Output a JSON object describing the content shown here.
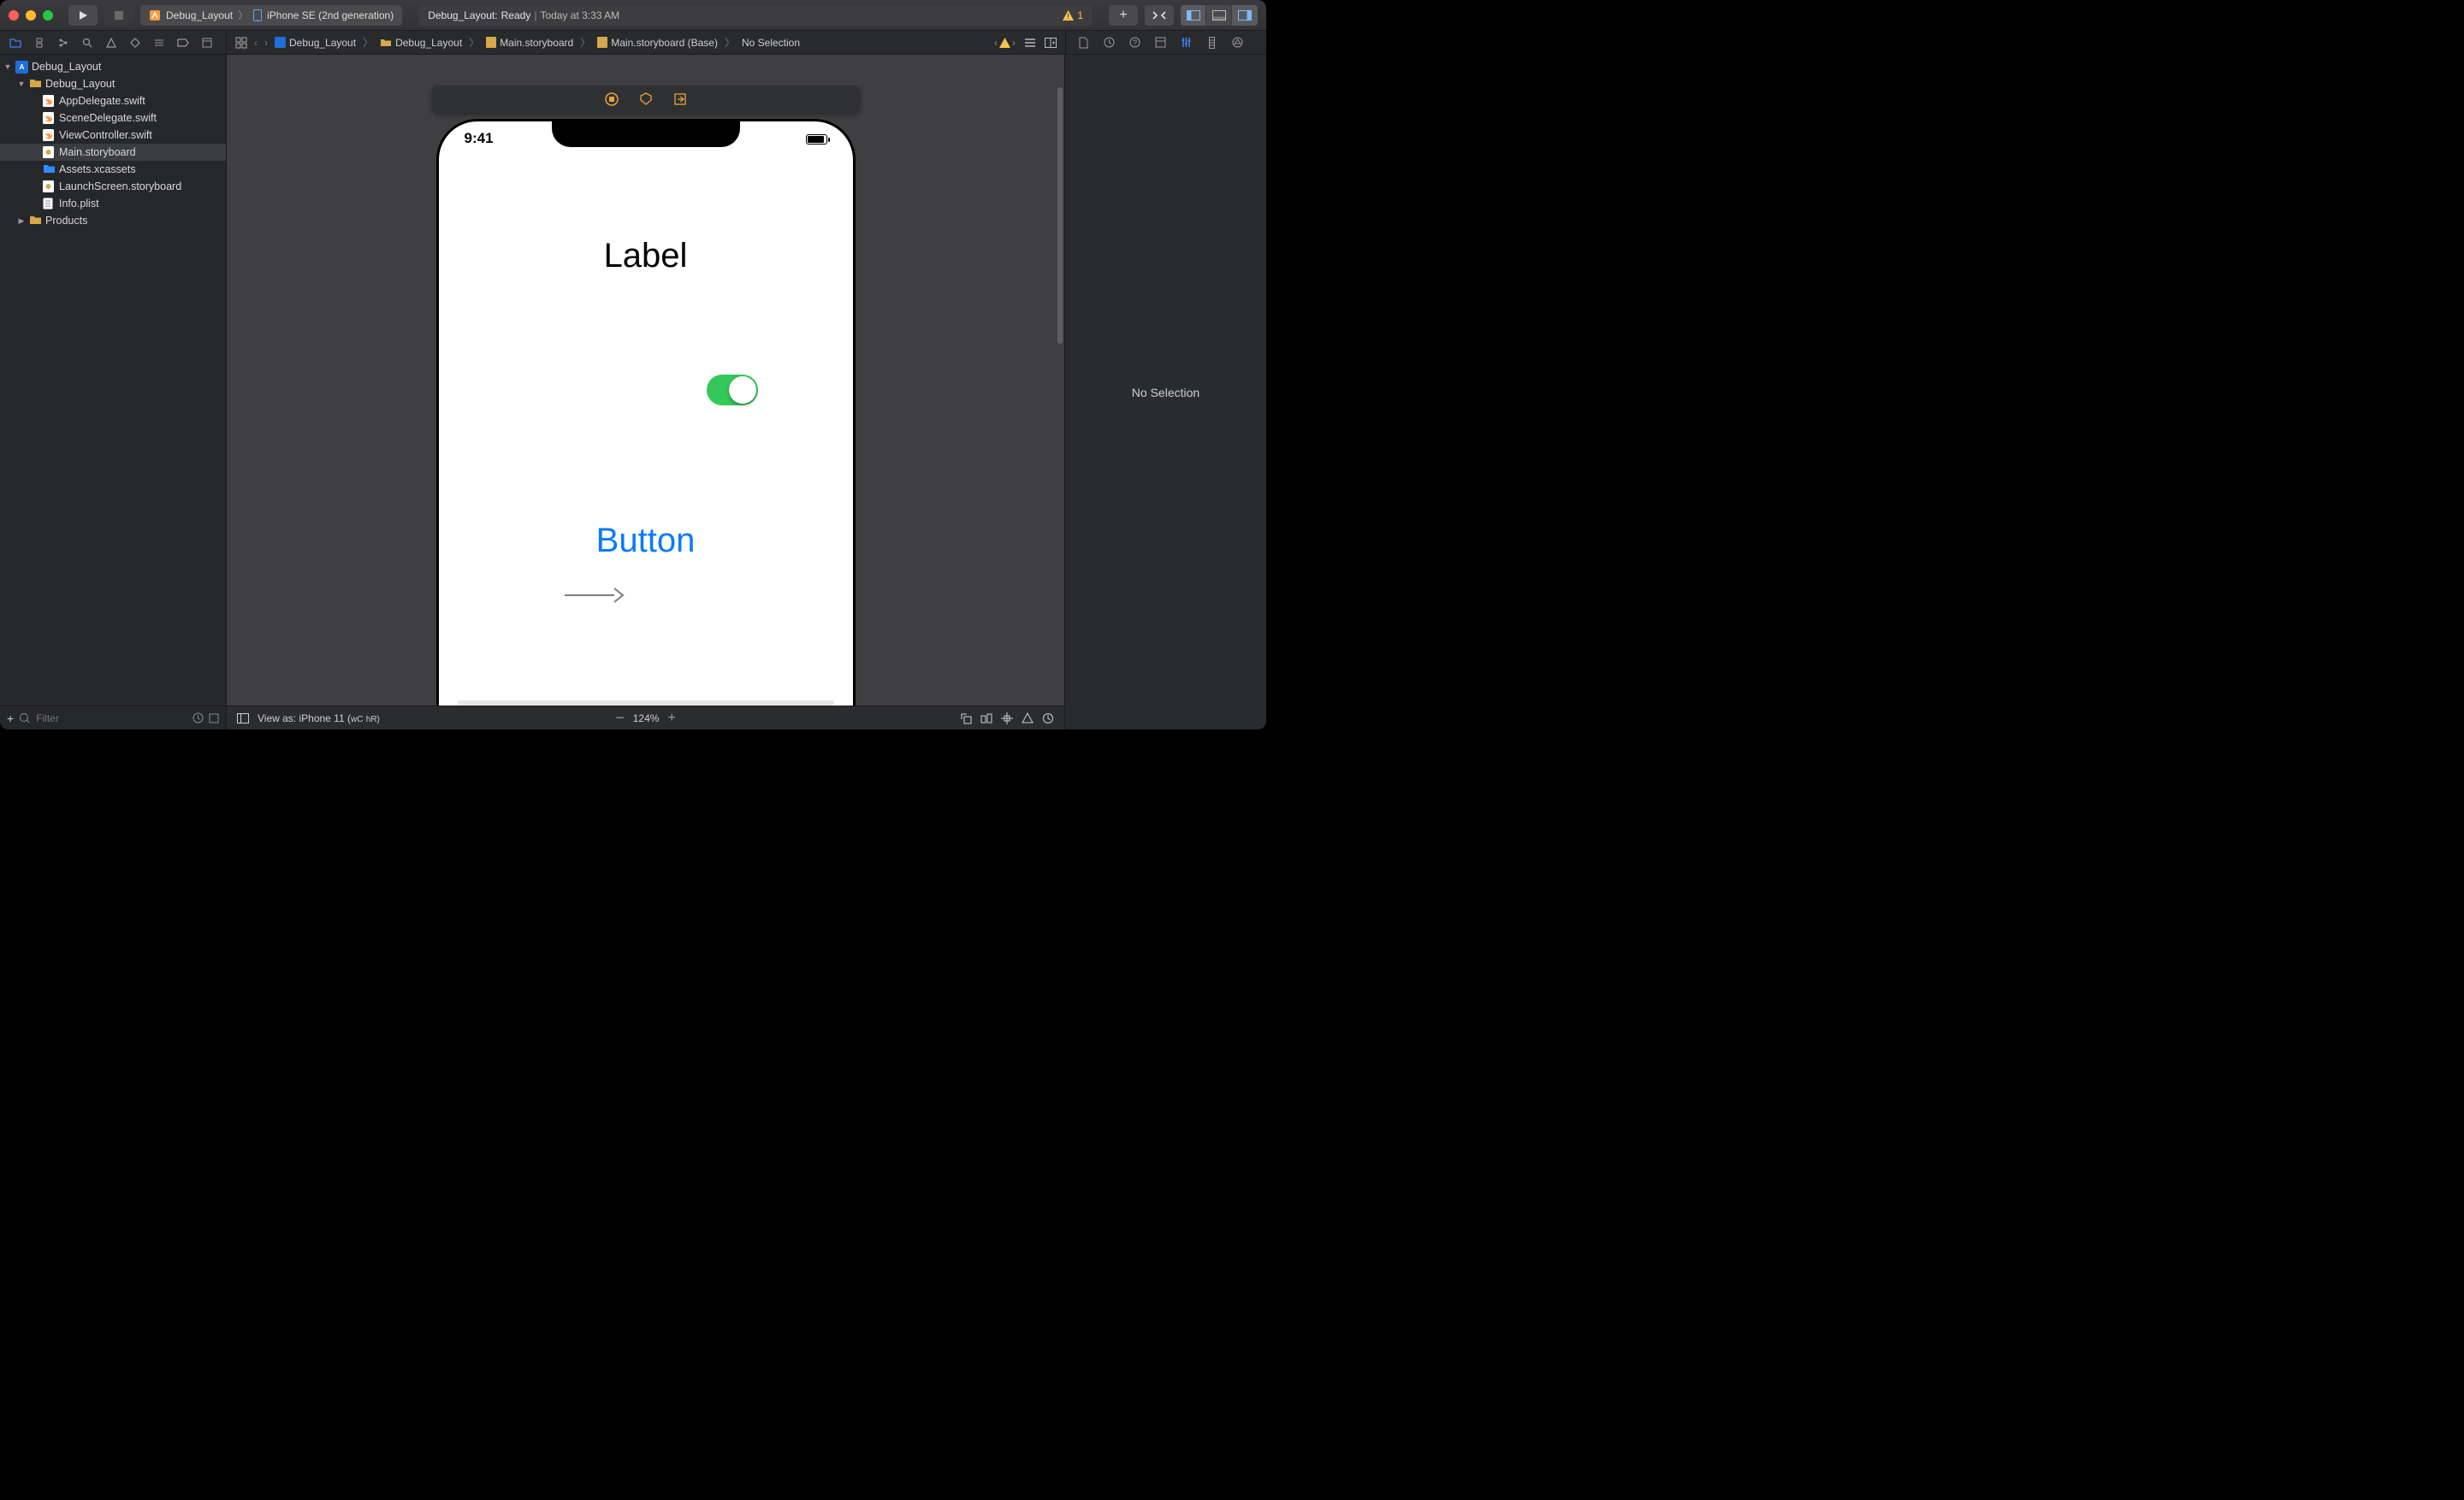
{
  "titlebar": {
    "scheme_target": "Debug_Layout",
    "scheme_device": "iPhone SE (2nd generation)",
    "status_project": "Debug_Layout",
    "status_state": "Ready",
    "status_time": "Today at 3:33 AM",
    "warning_count": "1"
  },
  "breadcrumb": {
    "items": [
      {
        "icon": "proj",
        "label": "Debug_Layout"
      },
      {
        "icon": "folder",
        "label": "Debug_Layout"
      },
      {
        "icon": "sb",
        "label": "Main.storyboard"
      },
      {
        "icon": "sb",
        "label": "Main.storyboard (Base)"
      },
      {
        "icon": "",
        "label": "No Selection"
      }
    ]
  },
  "navigator": {
    "items": [
      {
        "depth": 0,
        "icon": "proj",
        "label": "Debug_Layout",
        "disclosed": true
      },
      {
        "depth": 1,
        "icon": "folder",
        "label": "Debug_Layout",
        "disclosed": true
      },
      {
        "depth": 2,
        "icon": "swift",
        "label": "AppDelegate.swift"
      },
      {
        "depth": 2,
        "icon": "swift",
        "label": "SceneDelegate.swift"
      },
      {
        "depth": 2,
        "icon": "swift",
        "label": "ViewController.swift"
      },
      {
        "depth": 2,
        "icon": "sb",
        "label": "Main.storyboard",
        "selected": true
      },
      {
        "depth": 2,
        "icon": "assets",
        "label": "Assets.xcassets"
      },
      {
        "depth": 2,
        "icon": "sb",
        "label": "LaunchScreen.storyboard"
      },
      {
        "depth": 2,
        "icon": "plist",
        "label": "Info.plist"
      },
      {
        "depth": 1,
        "icon": "folder",
        "label": "Products",
        "disclosed": false
      }
    ],
    "filter_placeholder": "Filter"
  },
  "canvas": {
    "status_time": "9:41",
    "label_text": "Label",
    "button_text": "Button"
  },
  "footer": {
    "view_as": "View as: iPhone 11 (",
    "view_as_wc": "wC",
    "view_as_hr": "hR)",
    "zoom": "124%"
  },
  "inspector": {
    "empty_text": "No Selection"
  }
}
